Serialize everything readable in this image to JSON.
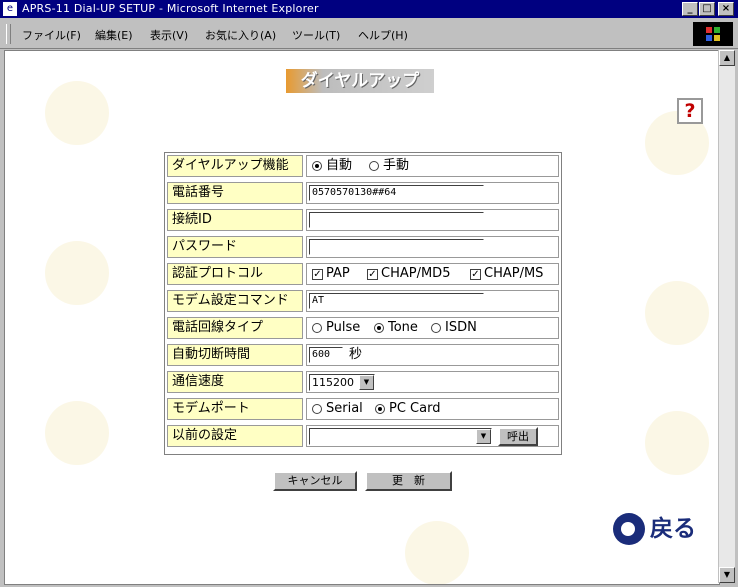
{
  "window": {
    "title": "APRS-11 Dial-UP SETUP - Microsoft Internet Explorer"
  },
  "menu": [
    "ファイル(F)",
    "編集(E)",
    "表示(V)",
    "お気に入り(A)",
    "ツール(T)",
    "ヘルプ(H)"
  ],
  "page": {
    "title": "ダイヤルアップ",
    "help": "?",
    "back_label": "戻る"
  },
  "form": {
    "dial": {
      "label": "ダイヤルアップ機能",
      "opt1": "自動",
      "opt2": "手動"
    },
    "phone": {
      "label": "電話番号",
      "value": "0570570130##64"
    },
    "login": {
      "label": "接続ID",
      "value": ""
    },
    "password": {
      "label": "パスワード",
      "value": ""
    },
    "auth": {
      "label": "認証プロトコル",
      "opt1": "PAP",
      "opt2": "CHAP/MD5",
      "opt3": "CHAP/MS"
    },
    "modem_cmd": {
      "label": "モデム設定コマンド",
      "value": "AT"
    },
    "line_type": {
      "label": "電話回線タイプ",
      "opt1": "Pulse",
      "opt2": "Tone",
      "opt3": "ISDN"
    },
    "auto_disconnect": {
      "label": "自動切断時間",
      "value": "600",
      "unit": "秒"
    },
    "speed": {
      "label": "通信速度",
      "value": "115200"
    },
    "modem_port": {
      "label": "モデムポート",
      "opt1": "Serial",
      "opt2": "PC Card"
    },
    "previous": {
      "label": "以前の設定",
      "value": "",
      "call": "呼出"
    }
  },
  "buttons": {
    "cancel": "キャンセル",
    "update": "更　新"
  }
}
